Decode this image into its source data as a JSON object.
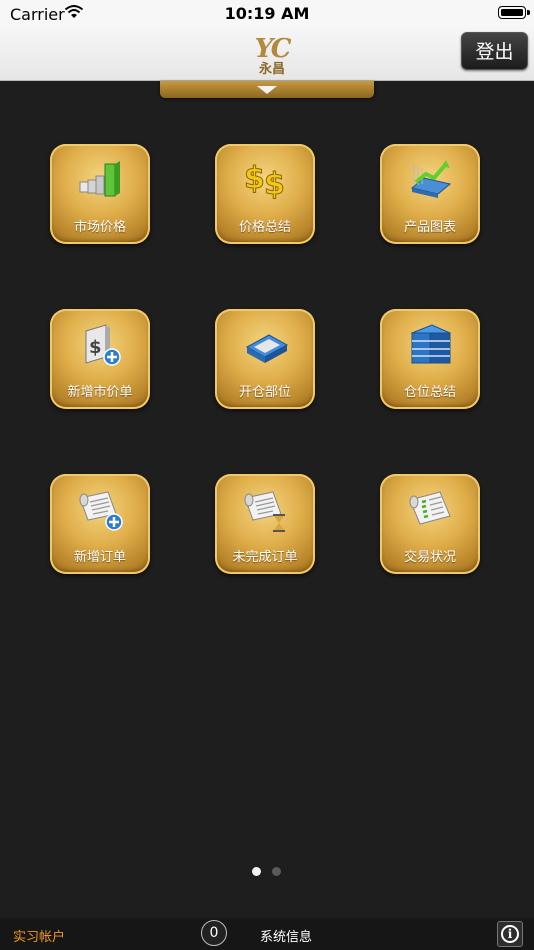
{
  "status_bar": {
    "carrier": "Carrier",
    "time": "10:19 AM"
  },
  "header": {
    "logo_mark": "YC",
    "logo_text": "永昌",
    "logout_label": "登出"
  },
  "menu": {
    "items": [
      {
        "label": "市场价格",
        "icon": "bar-chart-icon"
      },
      {
        "label": "价格总结",
        "icon": "dollar-signs-icon"
      },
      {
        "label": "产品图表",
        "icon": "line-chart-icon"
      },
      {
        "label": "新增市价单",
        "icon": "add-market-order-icon"
      },
      {
        "label": "开仓部位",
        "icon": "open-position-icon"
      },
      {
        "label": "仓位总结",
        "icon": "position-stack-icon"
      },
      {
        "label": "新增订单",
        "icon": "add-order-icon"
      },
      {
        "label": "未完成订单",
        "icon": "pending-order-icon"
      },
      {
        "label": "交易状况",
        "icon": "trade-status-icon"
      }
    ]
  },
  "pagination": {
    "current": 1,
    "total": 2
  },
  "footer": {
    "account_label": "实习帐户",
    "message_count": "0",
    "system_info_label": "系统信息",
    "info_glyph": "i"
  },
  "colors": {
    "gold": "#dfae4a",
    "account_orange": "#f19a1e",
    "background": "#1e1e1e"
  }
}
